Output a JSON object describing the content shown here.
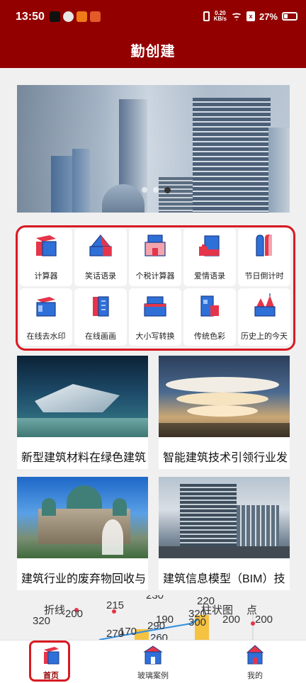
{
  "status_bar": {
    "time": "13:50",
    "net_speed_value": "0.20",
    "net_speed_unit": "KB/s",
    "battery": "27%"
  },
  "header": {
    "title": "勤创建"
  },
  "banner": {
    "slide_count": 3,
    "active_slide": 3
  },
  "functions": [
    {
      "label": "计算器",
      "icon": "calculator-icon"
    },
    {
      "label": "笑话语录",
      "icon": "joke-quotes-icon"
    },
    {
      "label": "个税计算器",
      "icon": "tax-calculator-icon"
    },
    {
      "label": "爱情语录",
      "icon": "love-quotes-icon"
    },
    {
      "label": "节日倒计时",
      "icon": "holiday-countdown-icon"
    },
    {
      "label": "在线去水印",
      "icon": "remove-watermark-icon"
    },
    {
      "label": "在线画画",
      "icon": "online-drawing-icon"
    },
    {
      "label": "大小写转换",
      "icon": "case-convert-icon"
    },
    {
      "label": "传统色彩",
      "icon": "traditional-colors-icon"
    },
    {
      "label": "历史上的今天",
      "icon": "history-today-icon"
    }
  ],
  "articles": [
    {
      "title": "新型建筑材料在绿色建筑"
    },
    {
      "title": "智能建筑技术引领行业发"
    },
    {
      "title": "建筑行业的废弃物回收与"
    },
    {
      "title": "建筑信息模型（BIM）技"
    }
  ],
  "chart_peek": {
    "labels": [
      "折线",
      "柱状图",
      "点"
    ],
    "values": [
      "320",
      "200",
      "215",
      "230",
      "270",
      "170",
      "290",
      "190",
      "260",
      "220",
      "320",
      "300",
      "200",
      "200"
    ]
  },
  "bottom_nav": [
    {
      "label": "首页",
      "icon": "home-building-icon",
      "active": true
    },
    {
      "label": "玻璃案例",
      "icon": "glass-case-building-icon",
      "active": false
    },
    {
      "label": "我的",
      "icon": "profile-building-icon",
      "active": false
    }
  ],
  "colors": {
    "brand": "#930000",
    "highlight": "#d81a22",
    "icon_blue": "#2f6fd8",
    "icon_red": "#e5354a"
  }
}
